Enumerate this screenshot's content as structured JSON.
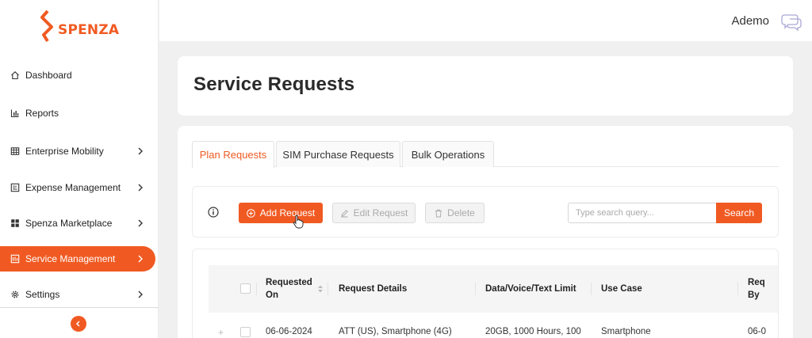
{
  "brand": {
    "name": "SPENZA",
    "color": "#f05a22"
  },
  "header": {
    "username": "Ademo",
    "user_icon": "chat-bubbles-icon"
  },
  "sidebar": {
    "items": [
      {
        "label": "Dashboard",
        "icon": "home-icon",
        "has_submenu": false,
        "active": false
      },
      {
        "label": "Reports",
        "icon": "bar-chart-icon",
        "has_submenu": false,
        "active": false
      },
      {
        "label": "Enterprise Mobility",
        "icon": "grid-icon",
        "has_submenu": true,
        "active": false
      },
      {
        "label": "Expense Management",
        "icon": "receipt-icon",
        "has_submenu": true,
        "active": false
      },
      {
        "label": "Spenza Marketplace",
        "icon": "apps-icon",
        "has_submenu": true,
        "active": false
      },
      {
        "label": "Service Management",
        "icon": "service-icon",
        "has_submenu": true,
        "active": true
      },
      {
        "label": "Settings",
        "icon": "gear-icon",
        "has_submenu": true,
        "active": false
      }
    ],
    "collapse_icon": "chevron-left-icon"
  },
  "page": {
    "title": "Service Requests"
  },
  "tabs": [
    {
      "label": "Plan Requests",
      "active": true
    },
    {
      "label": "SIM Purchase Requests",
      "active": false
    },
    {
      "label": "Bulk Operations",
      "active": false
    }
  ],
  "toolbar": {
    "add_label": "Add Request",
    "edit_label": "Edit Request",
    "delete_label": "Delete",
    "search_placeholder": "Type search query...",
    "search_value": "",
    "search_label": "Search"
  },
  "table": {
    "columns": [
      {
        "line1": "Requested",
        "line2": "On",
        "sortable": true
      },
      {
        "line1": "Request Details",
        "line2": "",
        "sortable": false
      },
      {
        "line1": "Data/Voice/Text Limit",
        "line2": "",
        "sortable": false
      },
      {
        "line1": "Use Case",
        "line2": "",
        "sortable": false
      },
      {
        "line1": "Req",
        "line2": "By",
        "sortable": false
      }
    ],
    "rows": [
      {
        "expand": "+",
        "requested_on": "06-06-2024",
        "details": "ATT (US), Smartphone (4G)",
        "limit": "20GB, 1000 Hours, 100",
        "use_case": "Smartphone",
        "requested_by": "06-0"
      }
    ]
  }
}
